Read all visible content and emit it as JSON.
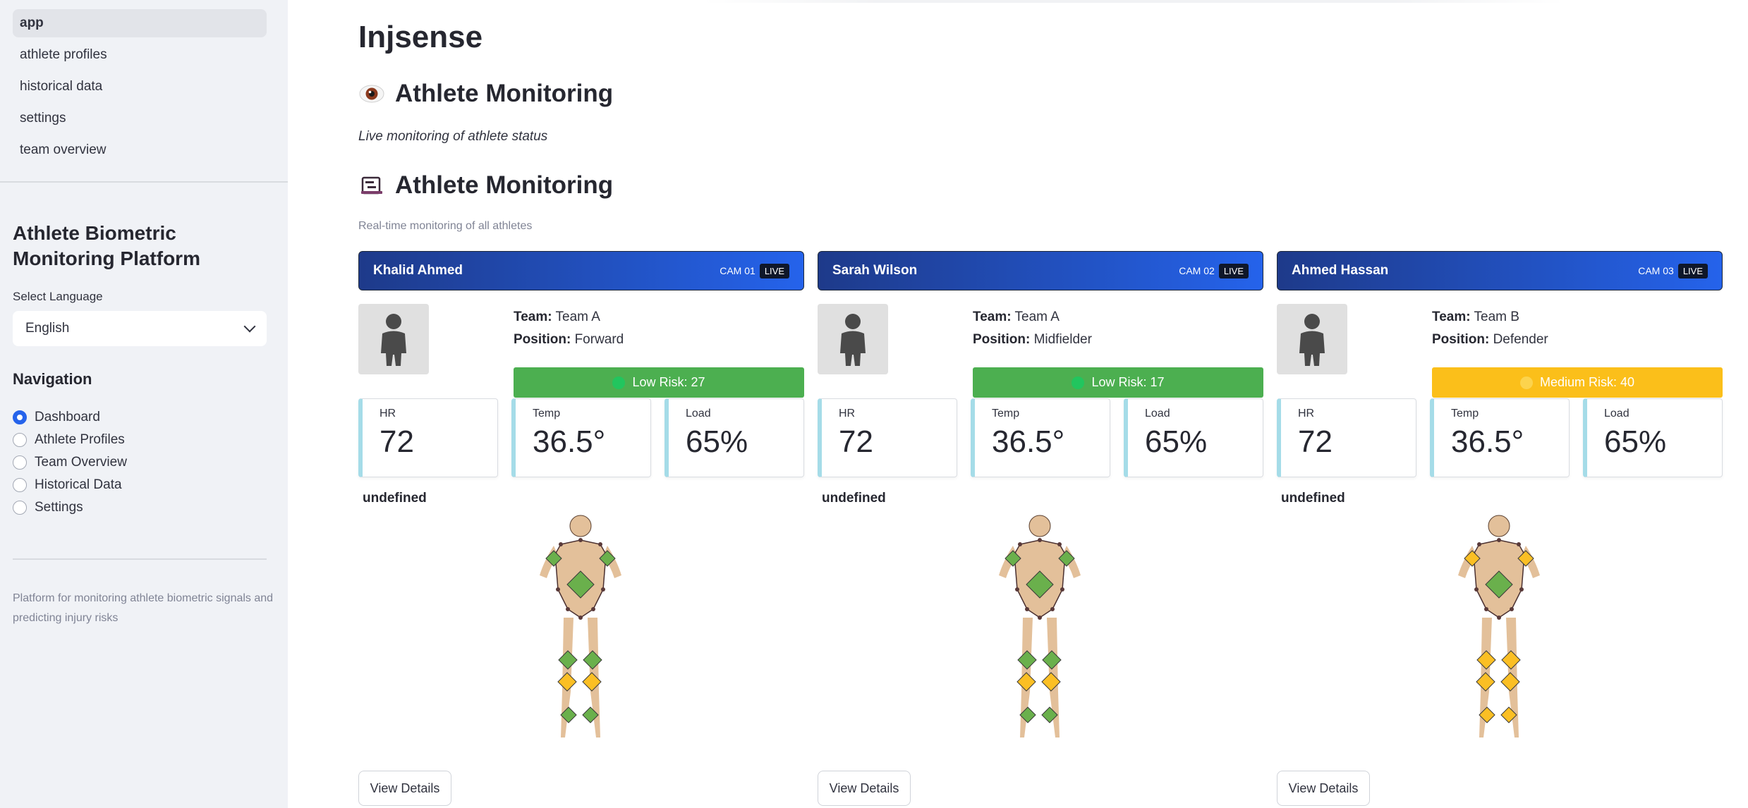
{
  "sidebar": {
    "pages": [
      {
        "label": "app",
        "active": true
      },
      {
        "label": "athlete profiles",
        "active": false
      },
      {
        "label": "historical data",
        "active": false
      },
      {
        "label": "settings",
        "active": false
      },
      {
        "label": "team overview",
        "active": false
      }
    ],
    "title": "Athlete Biometric Monitoring Platform",
    "language_label": "Select Language",
    "language_value": "English",
    "navigation_heading": "Navigation",
    "nav_options": [
      {
        "label": "Dashboard",
        "selected": true
      },
      {
        "label": "Athlete Profiles",
        "selected": false
      },
      {
        "label": "Team Overview",
        "selected": false
      },
      {
        "label": "Historical Data",
        "selected": false
      },
      {
        "label": "Settings",
        "selected": false
      }
    ],
    "footer": "Platform for monitoring athlete biometric signals and predicting injury risks"
  },
  "main": {
    "app_title": "Injsense",
    "section1_title": "Athlete Monitoring",
    "section1_subtitle": "Live monitoring of athlete status",
    "section2_title": "Athlete Monitoring",
    "section2_caption": "Real-time monitoring of all athletes"
  },
  "colors": {
    "low_risk": "#4caf50",
    "medium_risk": "#fbbf1a",
    "header_start": "#1e3a8a",
    "header_end": "#2563eb",
    "sensor_green": "#6ab04c",
    "sensor_yellow": "#fbbf24"
  },
  "athletes": [
    {
      "name": "Khalid Ahmed",
      "cam": "CAM 01",
      "live": "LIVE",
      "team_label": "Team:",
      "team": "Team A",
      "position_label": "Position:",
      "position": "Forward",
      "risk_text": "Low Risk: 27",
      "risk_level": "low",
      "hr_label": "HR",
      "hr": "72",
      "temp_label": "Temp",
      "temp": "36.5°",
      "load_label": "Load",
      "load": "65%",
      "status": "undefined",
      "sensors": {
        "shoulders": "green",
        "chest": "green",
        "upper_knees": "green",
        "knees": "yellow",
        "ankles": "green"
      },
      "button": "View Details"
    },
    {
      "name": "Sarah Wilson",
      "cam": "CAM 02",
      "live": "LIVE",
      "team_label": "Team:",
      "team": "Team A",
      "position_label": "Position:",
      "position": "Midfielder",
      "risk_text": "Low Risk: 17",
      "risk_level": "low",
      "hr_label": "HR",
      "hr": "72",
      "temp_label": "Temp",
      "temp": "36.5°",
      "load_label": "Load",
      "load": "65%",
      "status": "undefined",
      "sensors": {
        "shoulders": "green",
        "chest": "green",
        "upper_knees": "green",
        "knees": "yellow",
        "ankles": "green"
      },
      "button": "View Details"
    },
    {
      "name": "Ahmed Hassan",
      "cam": "CAM 03",
      "live": "LIVE",
      "team_label": "Team:",
      "team": "Team B",
      "position_label": "Position:",
      "position": "Defender",
      "risk_text": "Medium Risk: 40",
      "risk_level": "medium",
      "hr_label": "HR",
      "hr": "72",
      "temp_label": "Temp",
      "temp": "36.5°",
      "load_label": "Load",
      "load": "65%",
      "status": "undefined",
      "sensors": {
        "shoulders": "yellow",
        "chest": "green",
        "upper_knees": "yellow",
        "knees": "yellow",
        "ankles": "yellow"
      },
      "button": "View Details"
    }
  ]
}
